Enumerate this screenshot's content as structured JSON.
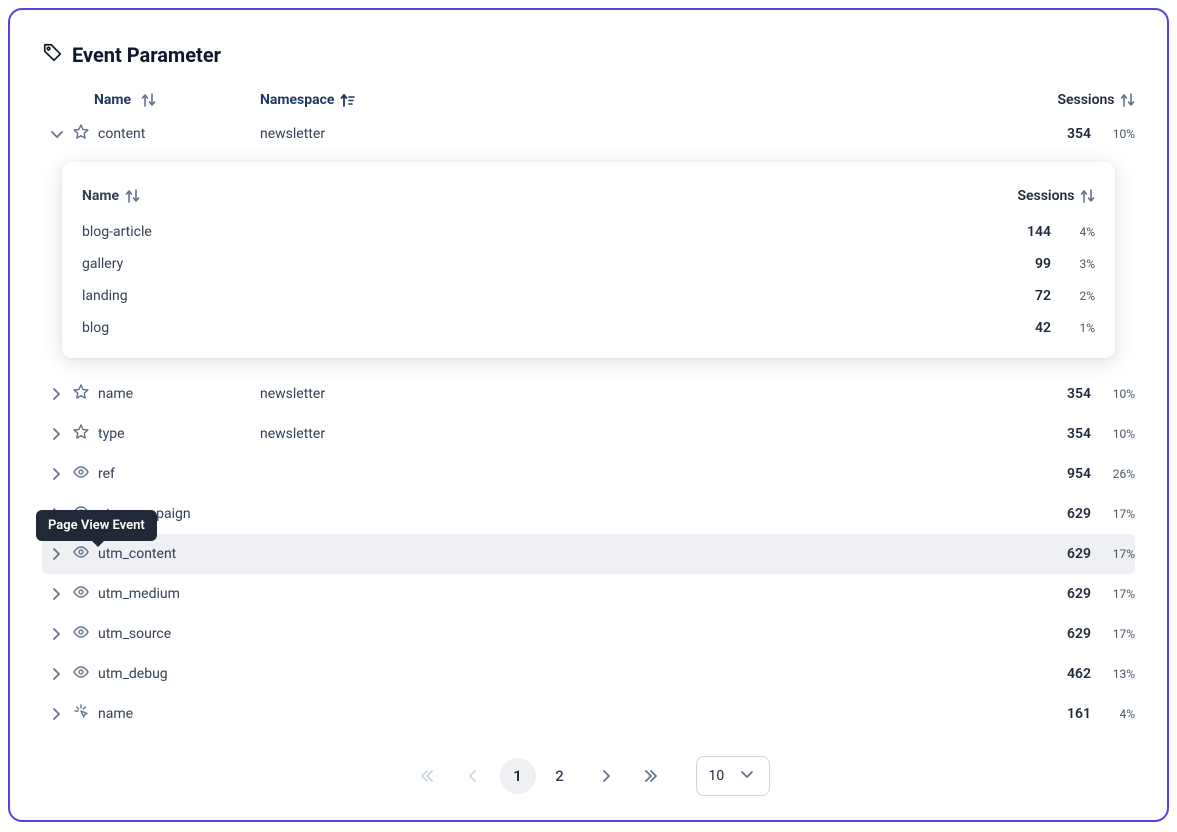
{
  "title": "Event Parameter",
  "tooltip": "Page View Event",
  "columns": {
    "name": "Name",
    "namespace": "Namespace",
    "sessions": "Sessions"
  },
  "rows": [
    {
      "icon": "star",
      "name": "content",
      "namespace": "newsletter",
      "sessions": "354",
      "pct": "10%",
      "expanded": true
    },
    {
      "icon": "star",
      "name": "name",
      "namespace": "newsletter",
      "sessions": "354",
      "pct": "10%"
    },
    {
      "icon": "star",
      "name": "type",
      "namespace": "newsletter",
      "sessions": "354",
      "pct": "10%"
    },
    {
      "icon": "eye",
      "name": "ref",
      "namespace": "",
      "sessions": "954",
      "pct": "26%"
    },
    {
      "icon": "eye",
      "name": "utm_campaign",
      "namespace": "",
      "sessions": "629",
      "pct": "17%"
    },
    {
      "icon": "eye",
      "name": "utm_content",
      "namespace": "",
      "sessions": "629",
      "pct": "17%",
      "hovered": true
    },
    {
      "icon": "eye",
      "name": "utm_medium",
      "namespace": "",
      "sessions": "629",
      "pct": "17%"
    },
    {
      "icon": "eye",
      "name": "utm_source",
      "namespace": "",
      "sessions": "629",
      "pct": "17%"
    },
    {
      "icon": "eye",
      "name": "utm_debug",
      "namespace": "",
      "sessions": "462",
      "pct": "13%"
    },
    {
      "icon": "click",
      "name": "name",
      "namespace": "",
      "sessions": "161",
      "pct": "4%"
    }
  ],
  "nested": {
    "columns": {
      "name": "Name",
      "sessions": "Sessions"
    },
    "rows": [
      {
        "name": "blog-article",
        "sessions": "144",
        "pct": "4%"
      },
      {
        "name": "gallery",
        "sessions": "99",
        "pct": "3%"
      },
      {
        "name": "landing",
        "sessions": "72",
        "pct": "2%"
      },
      {
        "name": "blog",
        "sessions": "42",
        "pct": "1%"
      }
    ]
  },
  "pagination": {
    "pages": [
      "1",
      "2"
    ],
    "active": 0,
    "size": "10"
  }
}
